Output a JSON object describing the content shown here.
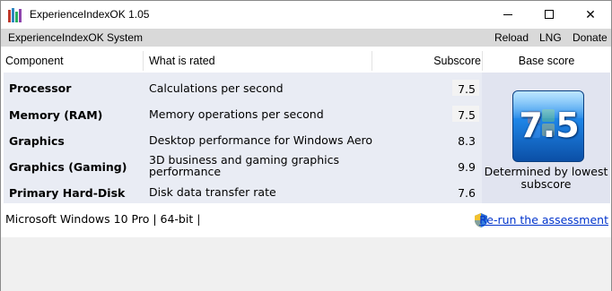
{
  "window": {
    "title": "ExperienceIndexOK 1.05",
    "minimize_icon": "minimize-icon",
    "maximize_icon": "maximize-icon",
    "close_glyph": "✕"
  },
  "menu": {
    "left": [
      {
        "label": "ExperienceIndexOK"
      },
      {
        "label": "System"
      }
    ],
    "right": [
      {
        "label": "Reload"
      },
      {
        "label": "LNG"
      },
      {
        "label": "Donate"
      }
    ]
  },
  "table": {
    "headers": {
      "component": "Component",
      "what": "What is rated",
      "subscore": "Subscore",
      "base": "Base score"
    },
    "rows": [
      {
        "component": "Processor",
        "what": "Calculations per second",
        "subscore": "7.5",
        "highlight": true
      },
      {
        "component": "Memory (RAM)",
        "what": "Memory operations per second",
        "subscore": "7.5",
        "highlight": true
      },
      {
        "component": "Graphics",
        "what": "Desktop performance for Windows Aero",
        "subscore": "8.3",
        "highlight": false
      },
      {
        "component": "Graphics (Gaming)",
        "what": "3D business and gaming graphics performance",
        "subscore": "9.9",
        "highlight": false
      },
      {
        "component": "Primary Hard-Disk",
        "what": "Disk data transfer rate",
        "subscore": "7.6",
        "highlight": false
      }
    ],
    "base_score": "7.5",
    "base_caption": "Determined by lowest subscore"
  },
  "footer": {
    "os": "Microsoft Windows 10 Pro | 64-bit |",
    "rerun": "Re-run the assessment",
    "rerun_icon": "uac-shield-icon"
  },
  "colors": {
    "menubar": "#d9d9d9",
    "rows_bg": "#e9ecf4",
    "link": "#0033cc",
    "badge": "#1f86e8"
  }
}
